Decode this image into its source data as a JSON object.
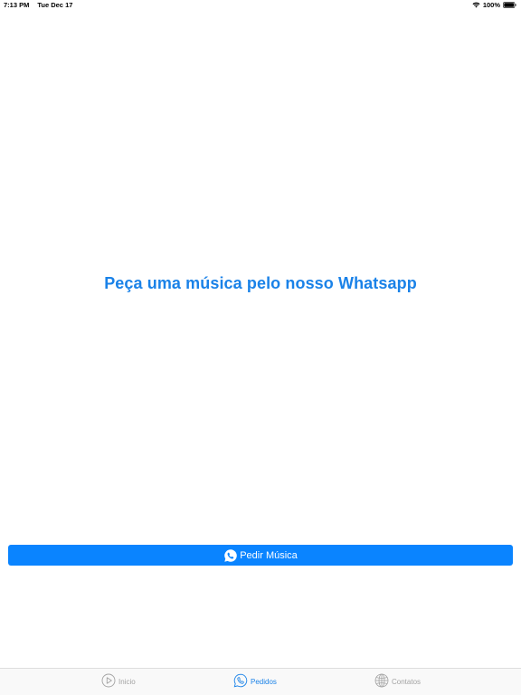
{
  "status_bar": {
    "time": "7:13 PM",
    "date": "Tue Dec 17",
    "battery": "100%"
  },
  "main": {
    "headline": "Peça uma música pelo nosso Whatsapp",
    "button_label": "Pedir Música"
  },
  "tab_bar": {
    "tabs": [
      {
        "label": "Inicio",
        "icon": "play-circle-icon",
        "active": false
      },
      {
        "label": "Pedidos",
        "icon": "phone-bubble-icon",
        "active": true
      },
      {
        "label": "Contatos",
        "icon": "globe-icon",
        "active": false
      }
    ]
  },
  "colors": {
    "accent": "#1a82e8",
    "button": "#0a84ff",
    "inactive_tab": "#a3a3a3"
  }
}
